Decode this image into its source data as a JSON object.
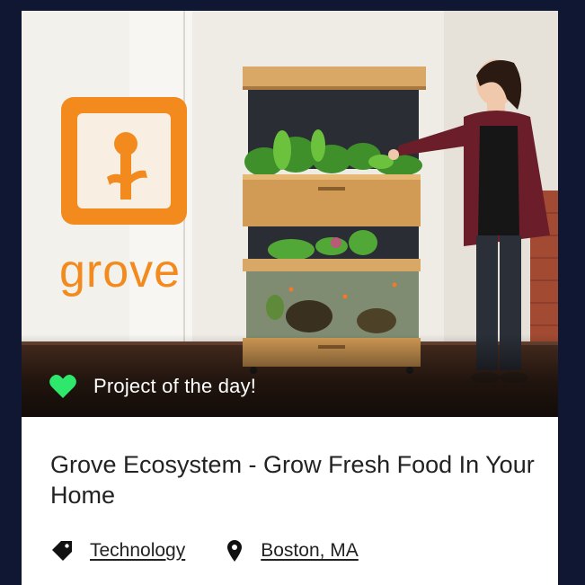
{
  "hero": {
    "brand_wordmark": "grove",
    "badge_label": "Project of the day!"
  },
  "project": {
    "title": "Grove Ecosystem - Grow Fresh Food In Your Home",
    "category": "Technology",
    "location": "Boston, MA"
  },
  "colors": {
    "accent_green": "#2ee86b",
    "brand_orange": "#f28a1e",
    "frame_navy": "#0f1733"
  },
  "icons": {
    "badge": "heart-icon",
    "category": "tag-icon",
    "location": "map-pin-icon"
  }
}
